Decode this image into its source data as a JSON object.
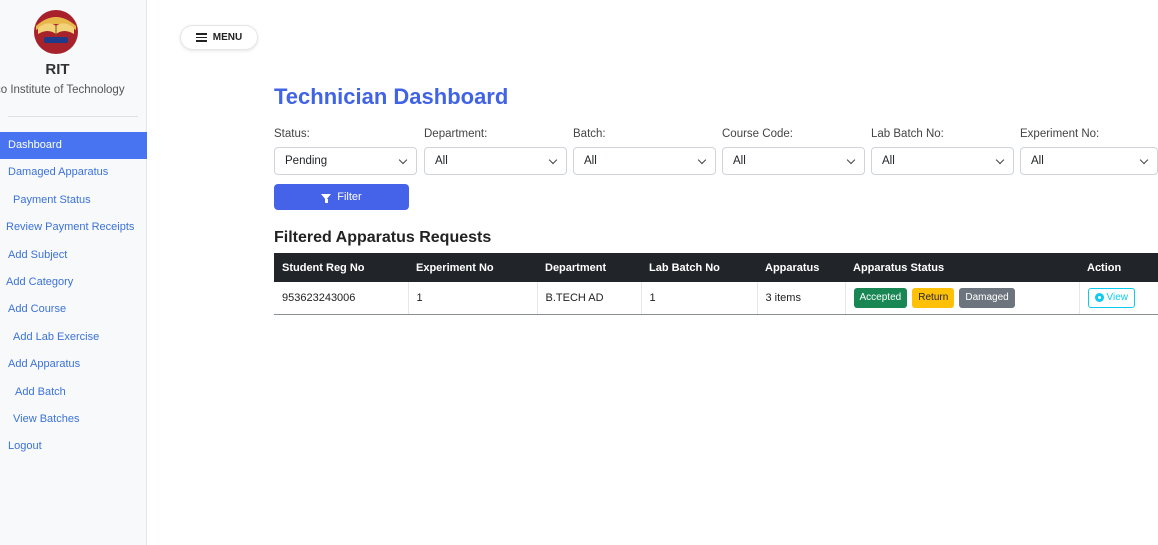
{
  "brand": {
    "title": "RIT",
    "subtitle": "co Institute of Technology"
  },
  "sidebar": {
    "items": [
      {
        "label": "Dashboard",
        "active": true
      },
      {
        "label": "Damaged Apparatus"
      },
      {
        "label": "Payment Status"
      },
      {
        "label": "Review Payment Receipts"
      },
      {
        "label": "Add Subject"
      },
      {
        "label": "Add Category"
      },
      {
        "label": "Add Course"
      },
      {
        "label": "Add Lab Exercise"
      },
      {
        "label": "Add Apparatus"
      },
      {
        "label": "Add Batch"
      },
      {
        "label": "View Batches"
      },
      {
        "label": "Logout"
      }
    ]
  },
  "header": {
    "menu_label": "MENU",
    "title": "Technician Dashboard"
  },
  "filters": [
    {
      "label": "Status:",
      "value": "Pending"
    },
    {
      "label": "Department:",
      "value": "All"
    },
    {
      "label": "Batch:",
      "value": "All"
    },
    {
      "label": "Course Code:",
      "value": "All"
    },
    {
      "label": "Lab Batch No:",
      "value": "All"
    },
    {
      "label": "Experiment No:",
      "value": "All"
    }
  ],
  "filter_button": "Filter",
  "section_title": "Filtered Apparatus Requests",
  "table": {
    "columns": [
      "Student Reg No",
      "Experiment No",
      "Department",
      "Lab Batch No",
      "Apparatus",
      "Apparatus Status",
      "Action"
    ],
    "rows": [
      {
        "reg_no": "953623243006",
        "experiment_no": "1",
        "department": "B.TECH AD",
        "lab_batch_no": "1",
        "apparatus": "3 items",
        "status_actions": [
          "Accepted",
          "Return",
          "Damaged"
        ],
        "action": "View"
      }
    ]
  },
  "colors": {
    "accent": "#4163e6",
    "sidebar_active": "#4874f2",
    "accepted": "#198754",
    "return": "#ffc107",
    "damaged": "#6c757d",
    "view": "#0dcaf0"
  }
}
